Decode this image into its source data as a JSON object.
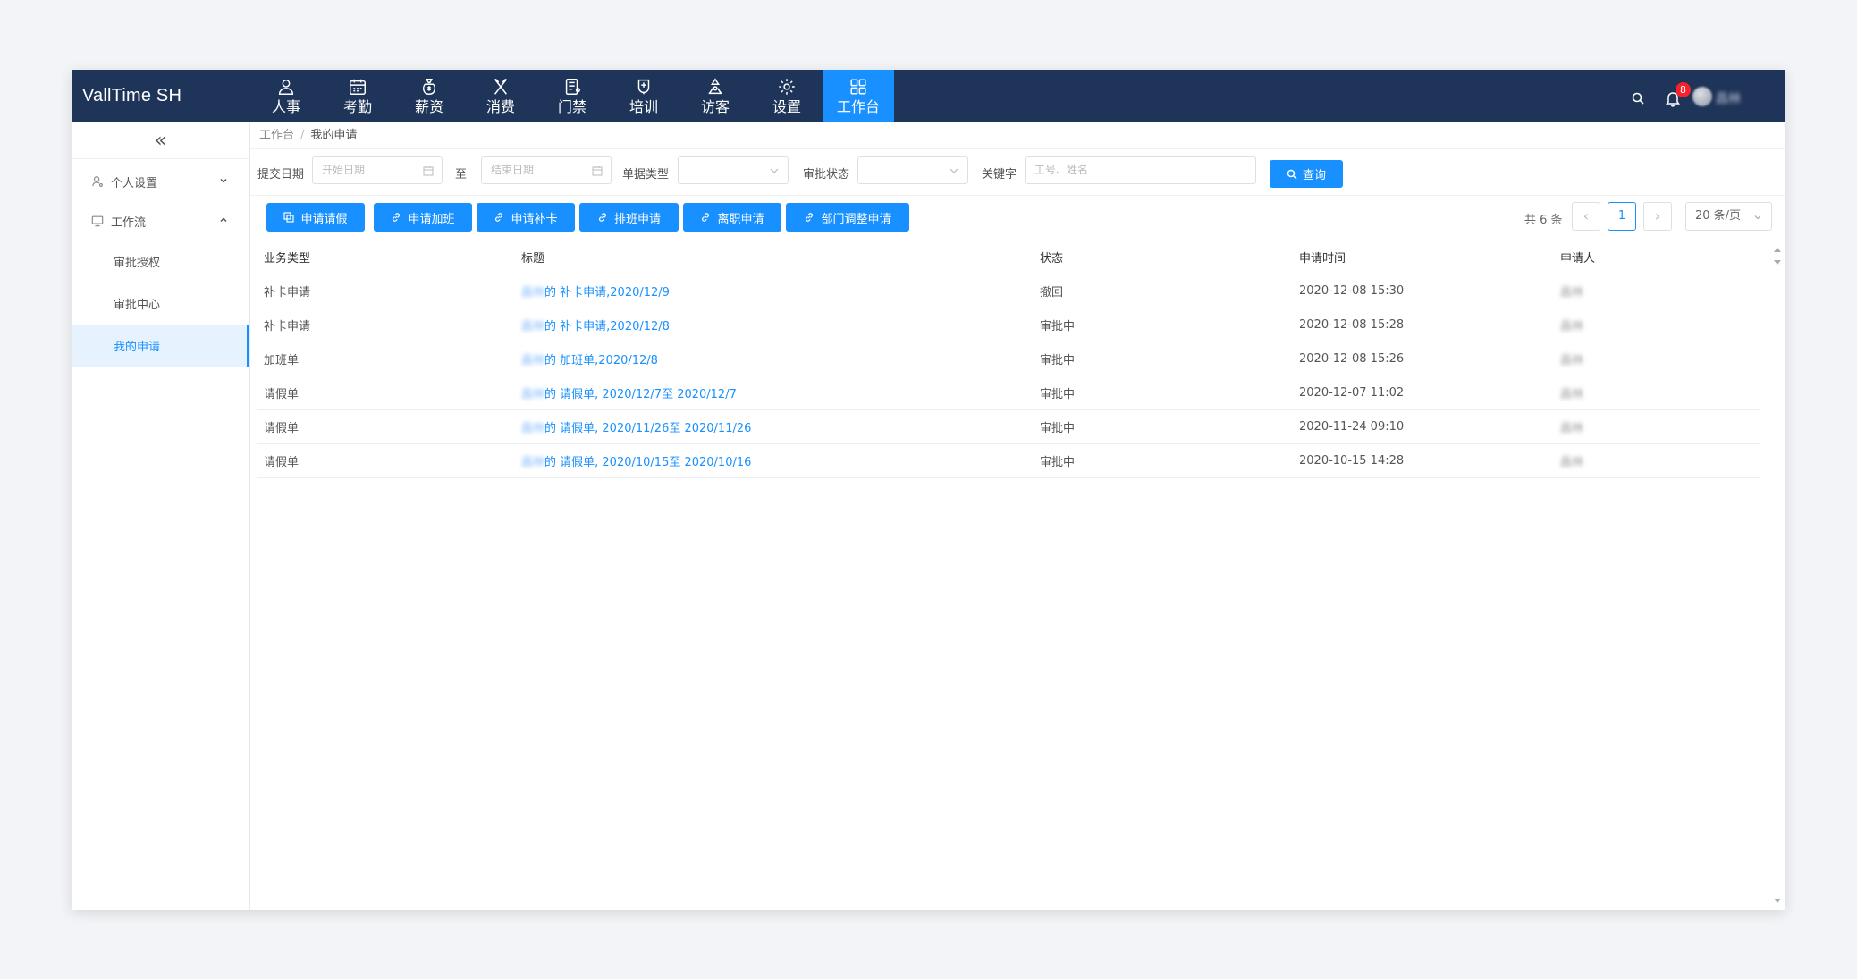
{
  "app": {
    "brand": "VallTime SH"
  },
  "nav": [
    {
      "label": "人事",
      "icon": "user-icon",
      "active": false
    },
    {
      "label": "考勤",
      "icon": "calendar-icon",
      "active": false
    },
    {
      "label": "薪资",
      "icon": "money-bag-icon",
      "active": false
    },
    {
      "label": "消费",
      "icon": "utensils-icon",
      "active": false
    },
    {
      "label": "门禁",
      "icon": "door-access-icon",
      "active": false
    },
    {
      "label": "培训",
      "icon": "training-icon",
      "active": false
    },
    {
      "label": "访客",
      "icon": "visitor-icon",
      "active": false
    },
    {
      "label": "设置",
      "icon": "gear-icon",
      "active": false
    },
    {
      "label": "工作台",
      "icon": "grid-icon",
      "active": true
    }
  ],
  "topbar": {
    "notification_count": "8",
    "user_name": "昌林"
  },
  "sidebar": {
    "collapse_glyph": "«",
    "groups": [
      {
        "label": "个人设置",
        "icon": "user-settings-icon",
        "expanded": false
      },
      {
        "label": "工作流",
        "icon": "monitor-icon",
        "expanded": true
      }
    ],
    "items": [
      {
        "label": "审批授权",
        "active": false
      },
      {
        "label": "审批中心",
        "active": false
      },
      {
        "label": "我的申请",
        "active": true
      }
    ]
  },
  "breadcrumb": {
    "root": "工作台",
    "sep": "/",
    "current": "我的申请"
  },
  "filters": {
    "submit_date_label": "提交日期",
    "start_placeholder": "开始日期",
    "to_label": "至",
    "end_placeholder": "结束日期",
    "doc_type_label": "单据类型",
    "doc_type_value": "",
    "approval_status_label": "审批状态",
    "approval_status_value": "",
    "keyword_label": "关键字",
    "keyword_placeholder": "工号、姓名",
    "query_button": "查询"
  },
  "actions": [
    {
      "label": "申请请假",
      "icon": "copy-icon"
    },
    {
      "label": "申请加班",
      "icon": "link-icon"
    },
    {
      "label": "申请补卡",
      "icon": "link-icon"
    },
    {
      "label": "排班申请",
      "icon": "link-icon"
    },
    {
      "label": "离职申请",
      "icon": "link-icon"
    },
    {
      "label": "部门调整申请",
      "icon": "link-icon"
    }
  ],
  "pagination": {
    "total_text": "共 6 条",
    "prev": "‹",
    "current": "1",
    "next": "›",
    "page_size": "20 条/页"
  },
  "table": {
    "headers": [
      "业务类型",
      "标题",
      "状态",
      "申请时间",
      "申请人"
    ],
    "rows": [
      {
        "type": "补卡申请",
        "title_name": "昌林",
        "title_text": "的 补卡申请,2020/12/9",
        "status": "撤回",
        "time": "2020-12-08 15:30",
        "applicant": "昌林"
      },
      {
        "type": "补卡申请",
        "title_name": "昌林",
        "title_text": "的 补卡申请,2020/12/8",
        "status": "审批中",
        "time": "2020-12-08 15:28",
        "applicant": "昌林"
      },
      {
        "type": "加班单",
        "title_name": "昌林",
        "title_text": "的 加班单,2020/12/8",
        "status": "审批中",
        "time": "2020-12-08 15:26",
        "applicant": "昌林"
      },
      {
        "type": "请假单",
        "title_name": "昌林",
        "title_text": "的 请假单, 2020/12/7至 2020/12/7",
        "status": "审批中",
        "time": "2020-12-07 11:02",
        "applicant": "昌林"
      },
      {
        "type": "请假单",
        "title_name": "昌林",
        "title_text": "的 请假单, 2020/11/26至 2020/11/26",
        "status": "审批中",
        "time": "2020-11-24 09:10",
        "applicant": "昌林"
      },
      {
        "type": "请假单",
        "title_name": "昌林",
        "title_text": "的 请假单, 2020/10/15至 2020/10/16",
        "status": "审批中",
        "time": "2020-10-15 14:28",
        "applicant": "昌林"
      }
    ]
  },
  "colors": {
    "topbar": "#1e3459",
    "accent": "#1890ff",
    "badge": "#f5222d"
  }
}
